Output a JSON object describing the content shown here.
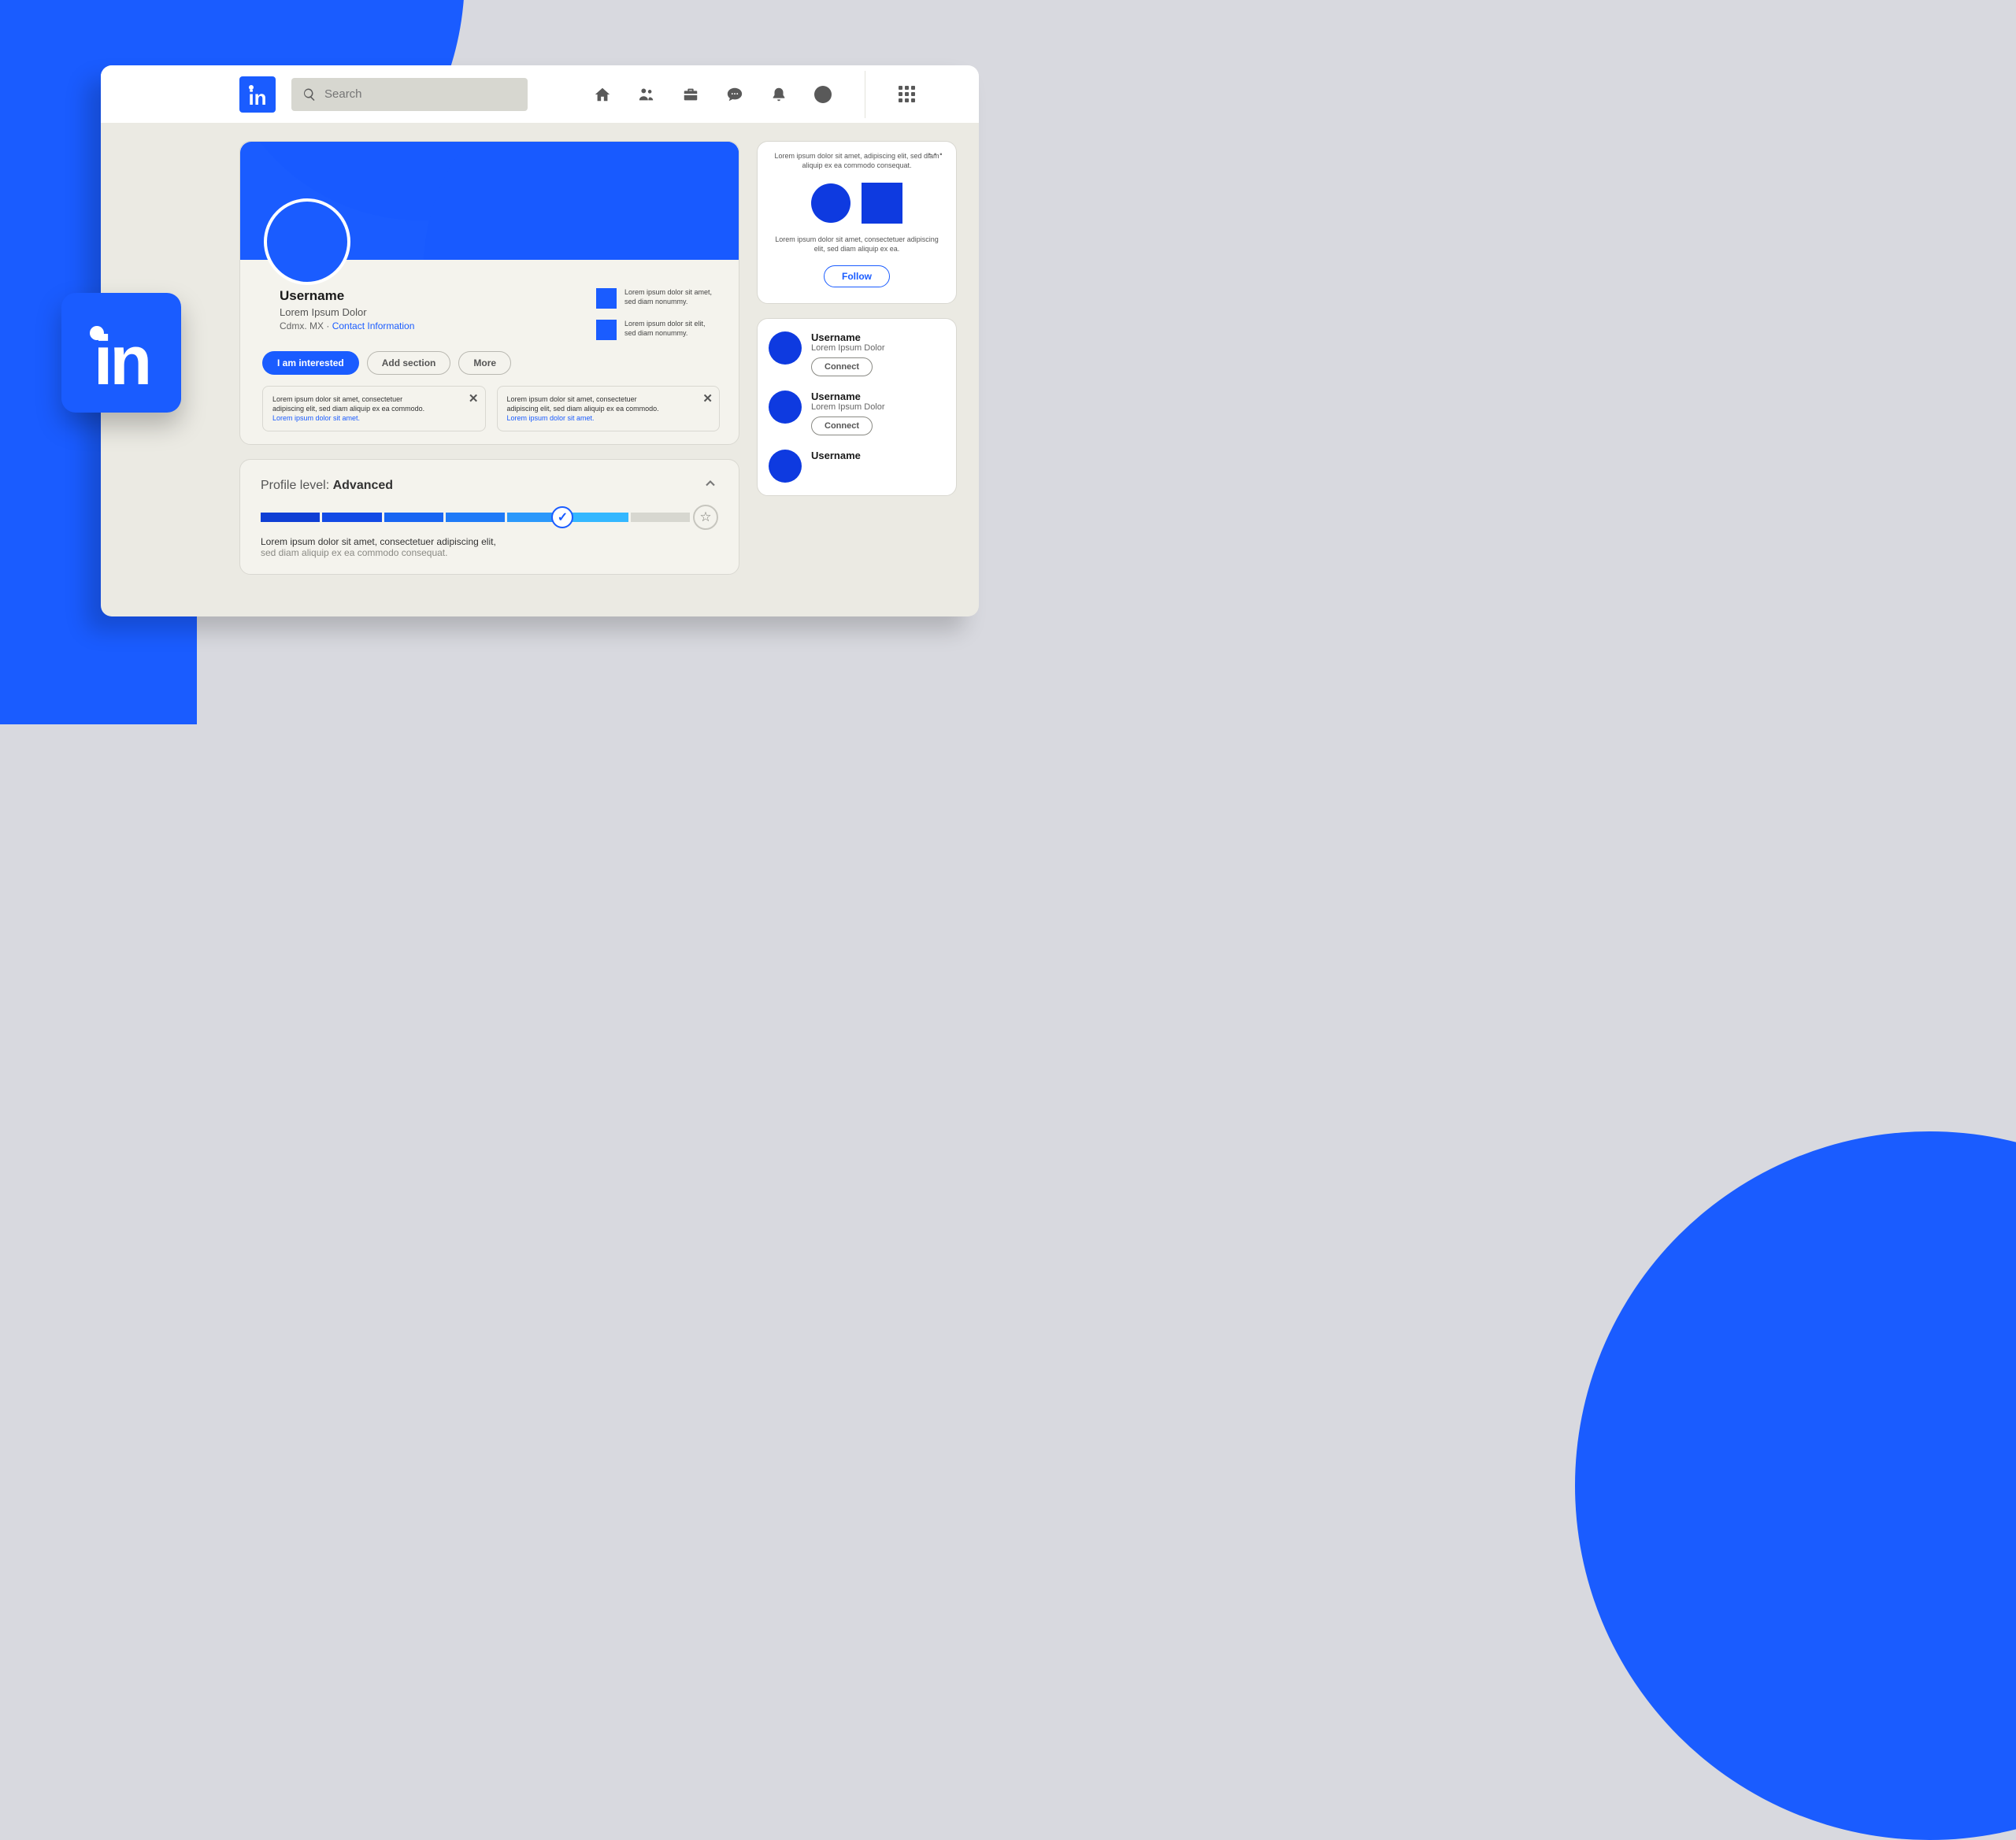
{
  "brand": "in",
  "search": {
    "placeholder": "Search"
  },
  "nav": {
    "home": "home-icon",
    "network": "people-icon",
    "jobs": "briefcase-icon",
    "messaging": "chat-icon",
    "notifications": "bell-icon",
    "me": "avatar-icon",
    "apps": "grid-icon"
  },
  "profile": {
    "name": "Username",
    "headline": "Lorem Ipsum Dolor",
    "location": "Cdmx. MX",
    "sep": " · ",
    "contact_link": "Contact Information",
    "meta": [
      {
        "line1": "Lorem ipsum dolor sit amet,",
        "line2": "sed diam nonummy."
      },
      {
        "line1": "Lorem ipsum dolor sit elit,",
        "line2": "sed diam nonummy."
      }
    ],
    "actions": {
      "interested": "I am interested",
      "add_section": "Add section",
      "more": "More"
    },
    "tips": [
      {
        "line1": "Lorem ipsum dolor sit amet, consectetuer",
        "line2": "adipiscing elit, sed diam aliquip ex ea commodo.",
        "link": "Lorem ipsum dolor sit amet."
      },
      {
        "line1": "Lorem ipsum dolor sit amet, consectetuer",
        "line2": "adipiscing elit, sed diam aliquip ex ea commodo.",
        "link": "Lorem ipsum dolor sit amet."
      }
    ]
  },
  "level": {
    "label": "Profile level: ",
    "value": "Advanced",
    "segments_filled": 6,
    "segments_total": 7,
    "copy_bold": "Lorem ipsum dolor sit amet, consectetuer adipiscing elit,",
    "copy_grey": "sed diam aliquip ex ea commodo consequat."
  },
  "promo": {
    "top": "Lorem ipsum dolor sit amet, adipiscing elit, sed diam aliquip ex ea commodo consequat.",
    "bottom": "Lorem ipsum dolor sit amet, consectetuer adipiscing elit, sed diam aliquip ex ea.",
    "follow": "Follow"
  },
  "suggestions": [
    {
      "name": "Username",
      "sub": "Lorem Ipsum Dolor",
      "cta": "Connect"
    },
    {
      "name": "Username",
      "sub": "Lorem Ipsum Dolor",
      "cta": "Connect"
    },
    {
      "name": "Username",
      "sub": "",
      "cta": ""
    }
  ]
}
